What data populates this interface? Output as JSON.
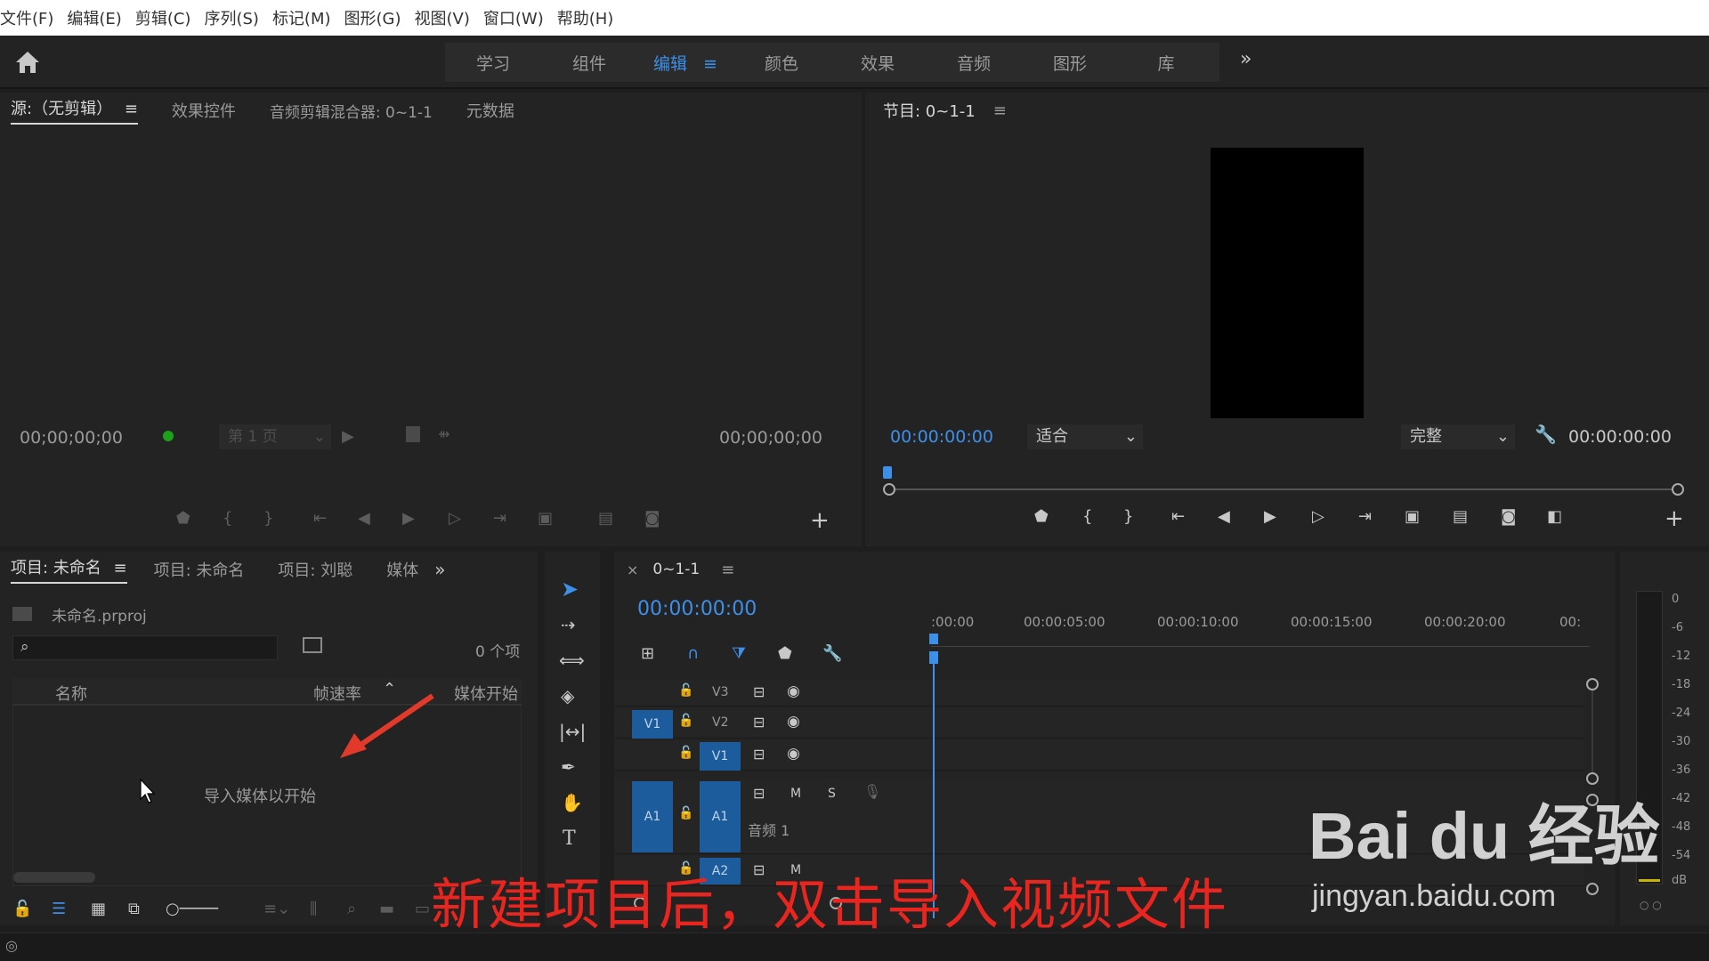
{
  "menu": [
    "文件(F)",
    "编辑(E)",
    "剪辑(C)",
    "序列(S)",
    "标记(M)",
    "图形(G)",
    "视图(V)",
    "窗口(W)",
    "帮助(H)"
  ],
  "workspaces": [
    "学习",
    "组件",
    "编辑",
    "颜色",
    "效果",
    "音频",
    "图形",
    "库"
  ],
  "active_workspace": "编辑",
  "source_panel": {
    "tabs": [
      "源:（无剪辑）",
      "效果控件",
      "音频剪辑混合器: 0~1-1",
      "元数据"
    ],
    "timecode_in": "00;00;00;00",
    "timecode_out": "00;00;00;00",
    "page_select": "第 1 页"
  },
  "program_panel": {
    "title": "节目: 0~1-1",
    "timecode": "00:00:00:00",
    "fit_select": "适合",
    "quality_select": "完整",
    "duration": "00:00:00:00"
  },
  "project_panel": {
    "tabs": [
      "项目: 未命名",
      "项目: 未命名",
      "项目: 刘聪",
      "媒体"
    ],
    "file_name": "未命名.prproj",
    "item_count": "0 个项",
    "columns": [
      "名称",
      "帧速率",
      "媒体开始"
    ],
    "empty_hint": "导入媒体以开始"
  },
  "timeline": {
    "sequence_name": "0~1-1",
    "timecode": "00:00:00:00",
    "ruler_labels": [
      ":00:00",
      "00:00:05:00",
      "00:00:10:00",
      "00:00:15:00",
      "00:00:20:00",
      "00:"
    ],
    "video_tracks": [
      "V3",
      "V2",
      "V1"
    ],
    "source_patch_video": "V1",
    "audio_tracks": [
      "A1",
      "A2"
    ],
    "source_patch_audio": "A1",
    "audio_track_name": "音频 1",
    "mute_label": "M",
    "solo_label": "S"
  },
  "audio_meter": {
    "labels": [
      "0",
      "-6",
      "-12",
      "-18",
      "-24",
      "-30",
      "-36",
      "-42",
      "-48",
      "-54",
      "dB"
    ]
  },
  "overlay": {
    "caption": "新建项目后，双击导入视频文件",
    "watermark_brand": "Bai du 经验",
    "watermark_url": "jingyan.baidu.com"
  },
  "colors": {
    "accent_blue": "#3d8fe8",
    "track_blue": "#1d5c9c",
    "caption_red": "#e8261f",
    "annotation_arrow": "#e23a2a"
  }
}
